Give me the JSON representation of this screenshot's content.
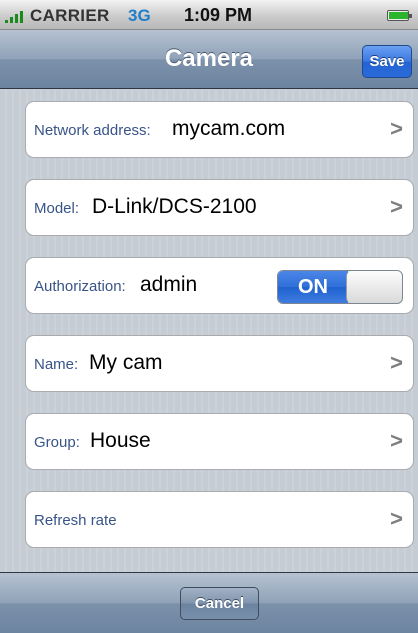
{
  "status_bar": {
    "carrier": "CARRIER",
    "network": "3G",
    "time": "1:09 PM"
  },
  "nav": {
    "title": "Camera",
    "save_label": "Save"
  },
  "cells": {
    "network_address": {
      "label": "Network address:",
      "value": "mycam.com"
    },
    "model": {
      "label": "Model:",
      "value": "D-Link/DCS-2100"
    },
    "authorization": {
      "label": "Authorization:",
      "value": "admin",
      "toggle_label": "ON"
    },
    "name": {
      "label": "Name:",
      "value": "My cam"
    },
    "group": {
      "label": "Group:",
      "value": "House"
    },
    "refresh_rate": {
      "label": "Refresh rate",
      "value": ""
    }
  },
  "toolbar": {
    "cancel_label": "Cancel"
  },
  "icons": {
    "chevron": ">"
  },
  "colors": {
    "accent_blue": "#2f6fd8",
    "label_blue": "#385487",
    "background": "#c5ccd4"
  }
}
